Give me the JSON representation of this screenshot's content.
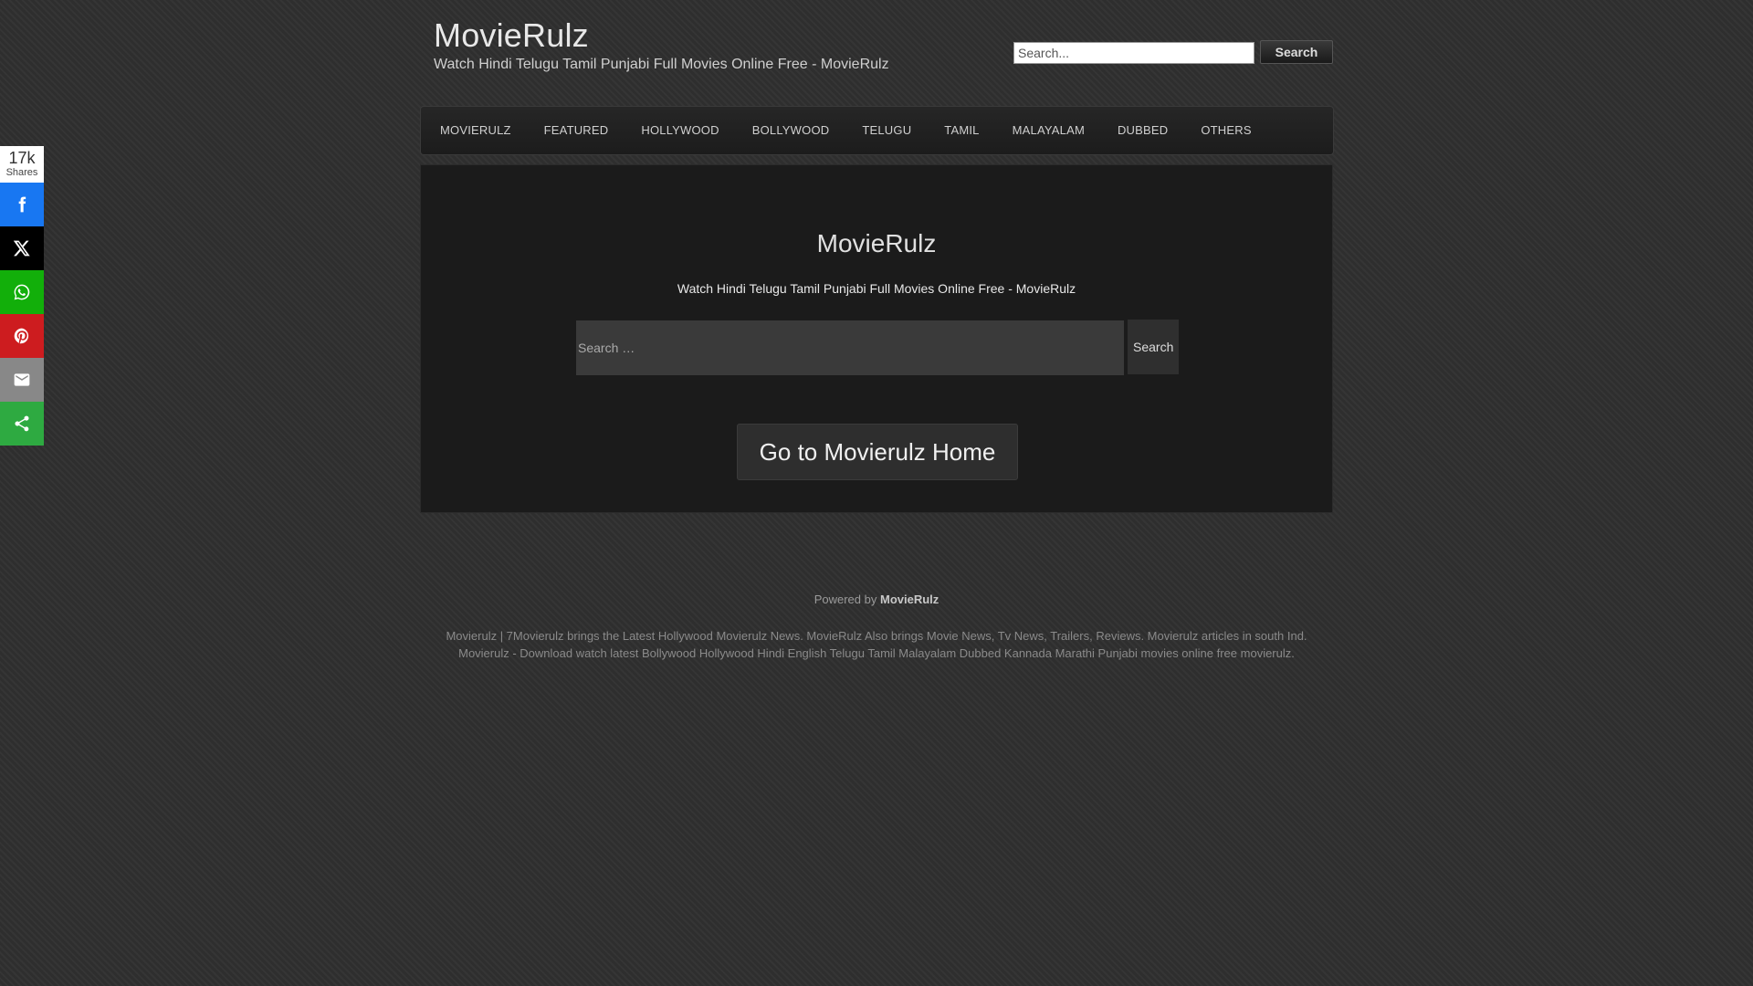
{
  "header": {
    "title": "MovieRulz",
    "description": "Watch Hindi Telugu Tamil Punjabi Full Movies Online Free - MovieRulz",
    "search_placeholder": "Search...",
    "search_button": "Search"
  },
  "nav": {
    "items": [
      {
        "label": "MOVIERULZ"
      },
      {
        "label": "FEATURED"
      },
      {
        "label": "HOLLYWOOD"
      },
      {
        "label": "BOLLYWOOD"
      },
      {
        "label": "TELUGU"
      },
      {
        "label": "TAMIL"
      },
      {
        "label": "MALAYALAM"
      },
      {
        "label": "DUBBED"
      },
      {
        "label": "OTHERS"
      }
    ]
  },
  "main": {
    "title": "MovieRulz",
    "description": "Watch Hindi Telugu Tamil Punjabi Full Movies Online Free - MovieRulz",
    "search_placeholder": "Search …",
    "search_button": "Search",
    "home_button": "Go to Movierulz Home"
  },
  "footer": {
    "powered_prefix": "Powered by",
    "powered_link": "MovieRulz",
    "line1": "Movierulz | 7Movierulz brings the Latest Hollywood Movierulz News. MovieRulz Also brings Movie News, Tv News, Trailers, Reviews. Movierulz articles in south Ind.",
    "line2": "Movierulz - Download watch latest Bollywood Hollywood Hindi English Telugu Tamil Malayalam Dubbed Kannada Marathi Punjabi movies online free movierulz."
  },
  "share": {
    "count": "17k",
    "count_label": "Shares",
    "buttons": [
      {
        "icon": "facebook-icon",
        "color": "#1877f2"
      },
      {
        "icon": "x-twitter-icon",
        "color": "#000000"
      },
      {
        "icon": "whatsapp-icon",
        "color": "#12af0a"
      },
      {
        "icon": "pinterest-icon",
        "color": "#cd1c1f"
      },
      {
        "icon": "email-icon",
        "color": "#888888"
      },
      {
        "icon": "share-icon",
        "color": "#2eaa41"
      }
    ]
  }
}
